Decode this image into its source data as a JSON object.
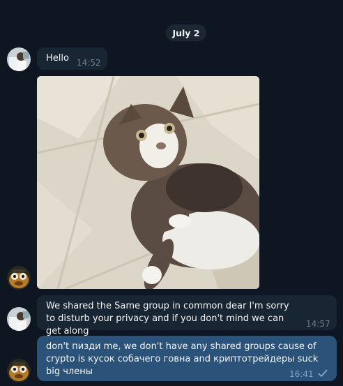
{
  "chat": {
    "date_label": "July 2",
    "messages": [
      {
        "text": "Hello",
        "time": "14:52"
      },
      {
        "text": "We shared the Same group in common dear I'm sorry to disturb your privacy and if you don't mind we can get along",
        "time": "14:57"
      },
      {
        "text": "don't пизди me, we don't have any shared groups cause of crypto is кусок собачего говна and криптотрейдеры suck big члены",
        "time": "16:41",
        "status": "sent"
      }
    ]
  },
  "icons": {
    "check": "single-check-icon"
  },
  "colors": {
    "background": "#0e1621",
    "incoming_bubble": "#182533",
    "outgoing_bubble": "#2b5278",
    "timestamp": "#6d7f8f"
  }
}
